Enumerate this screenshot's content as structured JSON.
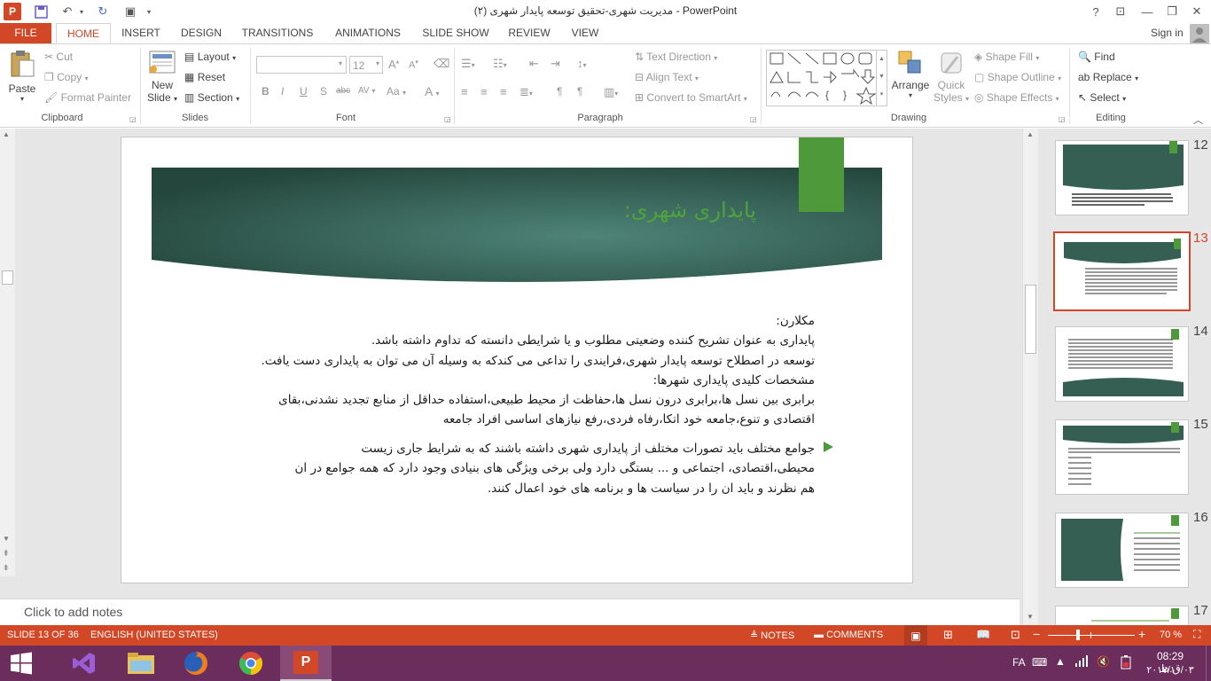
{
  "window": {
    "title": "مدیریت شهری-تحقیق توسعه پایدار شهری (۲) - PowerPoint",
    "help": "?",
    "minimize": "—",
    "maximize": "❐",
    "close": "✕",
    "sign_in": "Sign in"
  },
  "tabs": [
    "FILE",
    "HOME",
    "INSERT",
    "DESIGN",
    "TRANSITIONS",
    "ANIMATIONS",
    "SLIDE SHOW",
    "REVIEW",
    "VIEW"
  ],
  "ribbon": {
    "clipboard": {
      "paste": "Paste",
      "cut": "Cut",
      "copy": "Copy",
      "format_painter": "Format Painter",
      "label": "Clipboard"
    },
    "slides": {
      "new_slide_1": "New",
      "new_slide_2": "Slide",
      "layout": "Layout",
      "reset": "Reset",
      "section": "Section",
      "label": "Slides"
    },
    "font": {
      "size": "12",
      "bold": "B",
      "italic": "I",
      "underline": "U",
      "shadow": "S",
      "strike": "abc",
      "spacing": "AV",
      "case": "Aa",
      "label": "Font"
    },
    "paragraph": {
      "text_direction": "Text Direction",
      "align_text": "Align Text",
      "convert": "Convert to SmartArt",
      "label": "Paragraph"
    },
    "drawing": {
      "arrange": "Arrange",
      "quick_styles_1": "Quick",
      "quick_styles_2": "Styles",
      "shape_fill": "Shape Fill",
      "shape_outline": "Shape Outline",
      "shape_effects": "Shape Effects",
      "label": "Drawing"
    },
    "editing": {
      "find": "Find",
      "replace": "Replace",
      "select": "Select",
      "label": "Editing"
    }
  },
  "slide": {
    "title": "پایداری شهری:",
    "lines": [
      "مکلارن:",
      "پایداری به عنوان تشریح کننده وضعیتی مطلوب و یا شرایطی دانسته که تداوم داشته باشد.",
      "توسعه در اصطلاح توسعه پایدار شهری،فرایندی را تداعی می کندکه به وسیله آن می توان به پایداری دست یافت.",
      "مشخصات کلیدی پایداری شهرها:",
      "برابری بین نسل ها،برابری درون نسل ها،حفاظت از محیط طبیعی،استفاده حداقل از منابع تجدید نشدنی،بقای",
      "اقتصادی و تنوع،جامعه خود اتکا،رفاه فردی،رفع نیازهای اساسی افراد جامعه"
    ],
    "bullet_lines": [
      "جوامع مختلف باید تصورات مختلف از پایداری شهری داشته باشند که به شرایط جاری زیست",
      "محیطی،اقتصادی، اجتماعی و ... بستگی دارد ولی برخی ویژگی های بنیادی وجود دارد که همه جوامع در ان",
      "هم نظرند و باید ان را در سیاست ها و برنامه های خود اعمال کنند."
    ]
  },
  "notes_placeholder": "Click to add notes",
  "thumbnails": [
    "12",
    "13",
    "14",
    "15",
    "16",
    "17"
  ],
  "status": {
    "slide_info": "SLIDE 13 OF 36",
    "language": "ENGLISH (UNITED STATES)",
    "notes": "NOTES",
    "comments": "COMMENTS",
    "zoom": "70 %"
  },
  "tray": {
    "lang": "FA",
    "time": "08:29 ق.ظ",
    "date": "۲۰۱۷/۱۰/۰۳"
  },
  "colors": {
    "accent": "#d24726",
    "taskbar": "#6b2d5c",
    "slide_title": "#4ea33d",
    "banner": "#2e5a4c"
  }
}
